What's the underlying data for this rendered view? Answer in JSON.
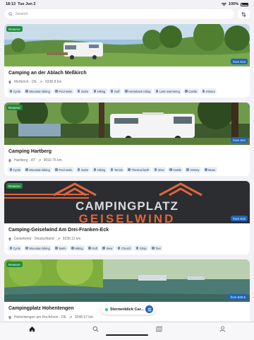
{
  "status": {
    "time": "18:13",
    "date": "Tue Jun 2",
    "battery": "100%"
  },
  "search": {
    "placeholder": "Search"
  },
  "colors": {
    "accent": "#1f63b8",
    "reserve": "#1f8a3b",
    "tag_bg": "#e9eef6"
  },
  "cards": [
    {
      "badge": "Reserve",
      "price": "from €13",
      "title": "Camping an der Ablach Meßkirch",
      "location": "Meßkirch · DE",
      "distance": "9338.8 km",
      "tags": [
        "Cycle",
        "Mountain biking",
        "Pool swim",
        "Swim",
        "Hiking",
        "Golf",
        "Horseback riding",
        "Lake swimming",
        "Castle",
        "History"
      ]
    },
    {
      "badge": "Reserve",
      "price": "from €44",
      "title": "Camping Hartberg",
      "location": "Hartberg · AT",
      "distance": "9692.75 km",
      "tags": [
        "Cycle",
        "Mountain biking",
        "Pool swim",
        "Swim",
        "Hiking",
        "Tennis",
        "Thermal bath",
        "View",
        "Castle",
        "History",
        "Muse"
      ]
    },
    {
      "badge": "Reserve",
      "price": "from €15",
      "title": "Camping-Geiselwind Am Drei-Franken-Eck",
      "location": "Geiselwind · Deutschland",
      "distance": "9236.11 km",
      "image_text_top": "CAMPINGPLATZ",
      "image_text_bottom": "GEISELWIND",
      "tags": [
        "Cycle",
        "Mountain biking",
        "Swim",
        "Hiking",
        "Golf",
        "View",
        "Church",
        "Shop",
        "Taxi"
      ]
    },
    {
      "badge": "Reserve",
      "price": "from €20.5",
      "title": "Campingplatz Hohentengen",
      "location": "Hohentengen am Hochrhein · DE",
      "distance": "9346.57 km",
      "tags": []
    }
  ],
  "floating_card": {
    "label": "Sternenblick Car..."
  },
  "tabs": [
    "home-icon",
    "search-icon",
    "map-icon",
    "profile-icon"
  ]
}
